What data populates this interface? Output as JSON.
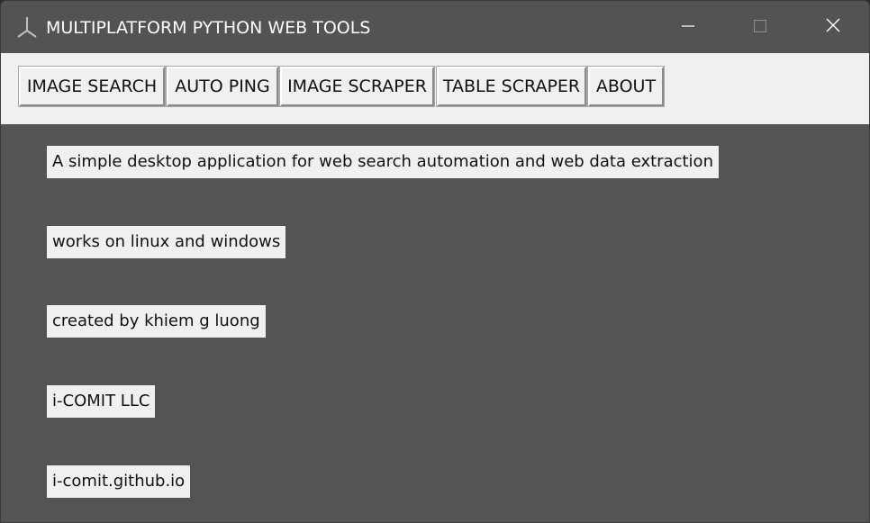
{
  "window": {
    "title": "MULTIPLATFORM PYTHON WEB TOOLS",
    "app_icon": "feather-tk-icon",
    "controls": {
      "minimize_icon": "minimize-icon",
      "maximize_icon": "maximize-icon",
      "close_icon": "close-icon"
    }
  },
  "toolbar": {
    "buttons": [
      {
        "label": "IMAGE SEARCH"
      },
      {
        "label": "AUTO PING"
      },
      {
        "label": "IMAGE SCRAPER"
      },
      {
        "label": "TABLE SCRAPER"
      },
      {
        "label": "ABOUT"
      }
    ]
  },
  "about": {
    "lines": [
      "A simple desktop application for web search automation and web data extraction",
      "works on linux and windows",
      "created by khiem g luong",
      "i-COMIT LLC",
      "i-comit.github.io"
    ]
  },
  "colors": {
    "titlebar_bg": "#535353",
    "content_bg": "#545454",
    "toolbar_bg": "#f0f0f0",
    "label_bg": "#f0f0f0",
    "text_dark": "#111111",
    "text_light": "#ffffff"
  }
}
